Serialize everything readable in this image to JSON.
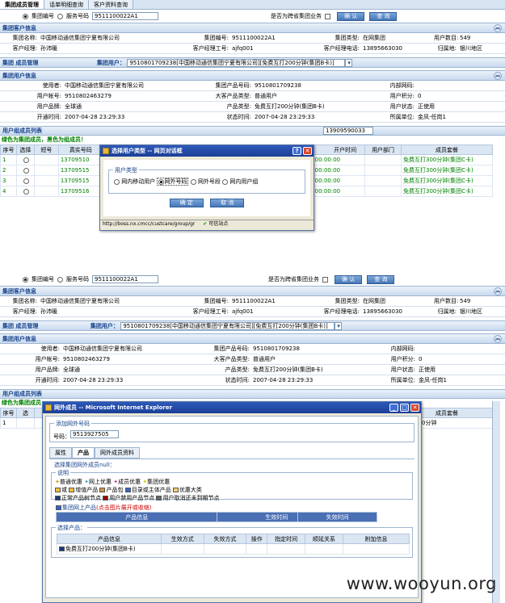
{
  "top": {
    "tabs": [
      "集团成员管理",
      "话单明细查询",
      "客户资料查询"
    ],
    "radio1": "集团编号",
    "radio2": "服务号码",
    "group_no_input": "9511100022A1",
    "cross_province_label": "是否为跨省集团业务",
    "confirm_btn": "确  认",
    "query_btn": "查  询",
    "group_info_title": "集团客户信息",
    "group_info": {
      "name_label": "集团名称:",
      "name": "中国移动通信集团宁夏有限公司",
      "no_label": "集团编号:",
      "no": "9511100022A1",
      "type_label": "集团类型:",
      "type": "在网集团",
      "user_count_label": "用户数目:",
      "user_count": "549",
      "manager_label": "客户经理:",
      "manager": "孙沛暖",
      "manager_no_label": "客户经理工号:",
      "manager_no": "ajfq001",
      "manager_tel_label": "客户经理电话:",
      "manager_tel": "13895663030",
      "region_label": "归属地:",
      "region": "银川地区"
    },
    "member_mgmt_title": "集团 成员管理",
    "group_user_label": "集团用户：",
    "group_user_value": "9510801709238[中国移动通信集团宁夏有限公司][免费互打200分钟(集团B卡)]",
    "user_info_title": "集团用户信息",
    "user_info": {
      "user_label": "使用者:",
      "user": "中国移动通信集团宁夏有限公司",
      "product_no_label": "集团产品号码:",
      "product_no": "9510801709238",
      "inner_net_label": "内部网码:",
      "inner_net": "",
      "account_label": "用户帐号:",
      "account": "9510802463279",
      "big_product_label": "大客产品类型:",
      "big_product": "普通用户",
      "points_label": "用户积分:",
      "points": "0",
      "brand_label": "用户品牌:",
      "brand": "全球通",
      "product_type_label": "产品类型:",
      "product_type": "免费互打200分钟(集团B卡)",
      "status_label": "用户状态:",
      "status": "正使用",
      "open_time_label": "开通时间:",
      "open_time": "2007-04-28 23:29:33",
      "status_time_label": "状态时间:",
      "status_time": "2007-04-28 23:29:33",
      "unit_label": "所属单位:",
      "unit": "金凤-任岗1"
    },
    "member_list_title": "用户组成员列表",
    "member_note": "绿色为集团成员，黑色为组成员！",
    "member_search": "13909590033",
    "cols": [
      "序号",
      "选择",
      "短号",
      "真实号码",
      "开户时间",
      "用户部门",
      "成员套餐"
    ],
    "rows": [
      {
        "no": "1",
        "short": "",
        "real": "13709510",
        "open": "21 00:00:00",
        "dept": "",
        "pkg": "免费互打300分钟(集团C卡)"
      },
      {
        "no": "2",
        "short": "",
        "real": "13709515",
        "open": "21 00:00:00",
        "dept": "",
        "pkg": "免费互打300分钟(集团C卡)"
      },
      {
        "no": "3",
        "short": "",
        "real": "13709515",
        "open": "21 00:00:00",
        "dept": "",
        "pkg": "免费互打300分钟(集团C卡)"
      },
      {
        "no": "4",
        "short": "",
        "real": "13709516",
        "open": "21 00:00:00",
        "dept": "",
        "pkg": "免费互打300分钟(集团C卡)"
      }
    ],
    "dialog": {
      "title": "选择用户类型 -- 网页对话框",
      "group_label": "用户类型",
      "opt1": "网内移动用户",
      "opt2": "网外号码",
      "opt3": "网外号段",
      "opt4": "网内用户组",
      "ok": "确  定",
      "cancel": "取  消",
      "status_url": "http://boss.nx.cmcc/custcare/group/gr",
      "status_trust": "可信站点"
    }
  },
  "bottom": {
    "member_list_title": "用户组成员列表",
    "member_note": "绿色为集团成员",
    "cols_left": [
      "序号",
      "选"
    ],
    "pkg_col": "成员套餐",
    "row1_no": "1",
    "row1_pkg": "拟同200分钟",
    "dialog": {
      "title": "网外成员 -- Microsoft Internet Explorer",
      "add_title": "添加网外号码",
      "number_label": "号码：",
      "number": "9513927505",
      "tabs": [
        "属性",
        "产品",
        "网外成员资料"
      ],
      "choose_title": "选择集团网外成员null：",
      "legend_title": "说明",
      "legend_items": [
        "普通优惠",
        "网上优惠",
        "成员优惠",
        "集团优惠"
      ],
      "legend_items2": [
        "或",
        "增值产品",
        "产品包",
        "目录或主体产品",
        "优惠大类"
      ],
      "legend_items3": [
        "正常产品树节点",
        "用户禁用产品节点",
        "用户取消还未到期节点"
      ],
      "group_net_product": "集团网上产品",
      "click_hint": "(点击图片展开或收缩)",
      "grid1_cols": [
        "产品信息",
        "生效时间",
        "失效时间"
      ],
      "select_product": "选择产品：",
      "grid2_cols": [
        "产品信息",
        "生效方式",
        "失效方式",
        "操作",
        "指定时间",
        "顺延关系",
        "附加信息"
      ],
      "grid2_row": "免费互打200分钟(集团B卡)"
    }
  },
  "watermark": "www.wooyun.org"
}
